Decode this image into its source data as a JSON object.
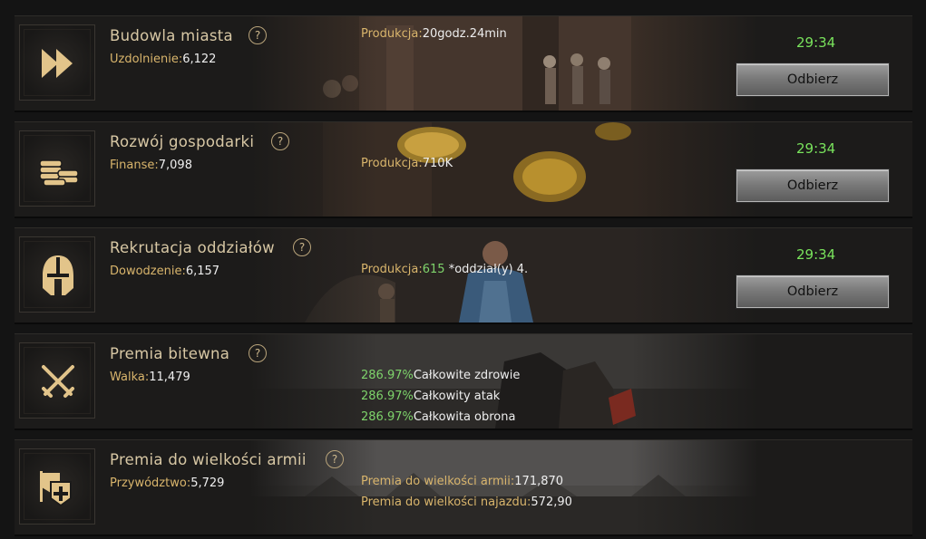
{
  "rows": [
    {
      "icon": "fast-forward-icon",
      "title": "Budowla miasta",
      "help": "?",
      "stat_label": "Uzdolnienie:",
      "stat_value": "6,122",
      "lines": [
        {
          "label": "Produkcja:",
          "value": "20godz.24min"
        }
      ],
      "timer": "29:34",
      "button": "Odbierz"
    },
    {
      "icon": "coin-stack-icon",
      "title": "Rozwój gospodarki",
      "help": "?",
      "stat_label": "Finanse:",
      "stat_value": "7,098",
      "lines": [
        {
          "label": "Produkcja:",
          "value": "710K"
        }
      ],
      "timer": "29:34",
      "button": "Odbierz"
    },
    {
      "icon": "helmet-icon",
      "title": "Rekrutacja oddziałów",
      "help": "?",
      "stat_label": "Dowodzenie:",
      "stat_value": "6,157",
      "lines": [
        {
          "label": "Produkcja:",
          "green": "615",
          "value": " *oddział(y) 4."
        }
      ],
      "timer": "29:34",
      "button": "Odbierz"
    },
    {
      "icon": "crossed-swords-icon",
      "title": "Premia bitewna",
      "help": "?",
      "stat_label": "Walka:",
      "stat_value": "11,479",
      "lines": [
        {
          "green": "286.97%",
          "value": "Całkowite zdrowie"
        },
        {
          "green": "286.97%",
          "value": "Całkowity atak"
        },
        {
          "green": "286.97%",
          "value": "Całkowita obrona"
        }
      ]
    },
    {
      "icon": "army-banner-icon",
      "title": "Premia do wielkości armii",
      "help": "?",
      "stat_label": "Przywództwo:",
      "stat_value": "5,729",
      "lines": [
        {
          "label": "Premia do wielkości armii:",
          "value": "171,870"
        },
        {
          "label": "Premia do wielkości najazdu:",
          "value": "572,90"
        }
      ]
    }
  ],
  "colors": {
    "accent_gold": "#d9b56c",
    "title": "#d7c7a4",
    "bonus_green": "#7ed36b",
    "timer_green": "#79e35c"
  }
}
